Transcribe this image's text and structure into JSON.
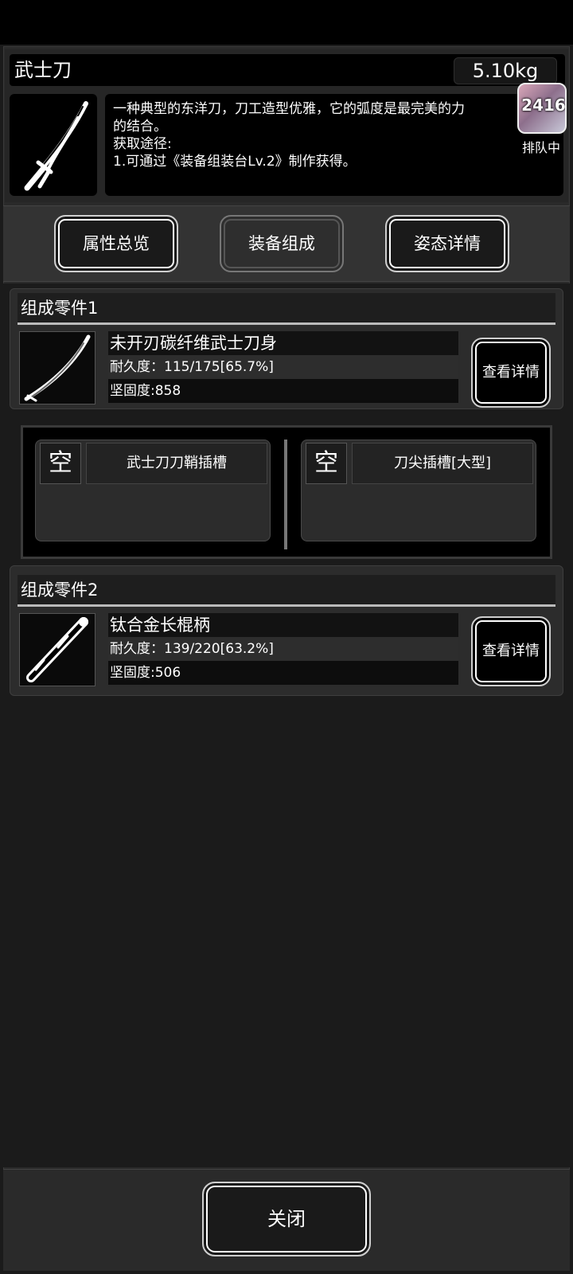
{
  "item": {
    "name": "武士刀",
    "weight": "5.10kg",
    "description_lines": [
      "一种典型的东洋刀，刀工造型优雅，它的弧度是最完美的力",
      "的结合。",
      "获取途径:",
      "1.可通过《装备组装台Lv.2》制作获得。"
    ]
  },
  "floating_badge": {
    "count": "2416",
    "label": "排队中"
  },
  "tabs": [
    {
      "label": "属性总览",
      "active": false
    },
    {
      "label": "装备组成",
      "active": true
    },
    {
      "label": "姿态详情",
      "active": false
    }
  ],
  "parts": [
    {
      "header": "组成零件1",
      "name": "未开刃碳纤维武士刀身",
      "durability": "耐久度：115/175[65.7%]",
      "hardness": "坚固度:858",
      "detail_label": "查看详情"
    },
    {
      "header": "组成零件2",
      "name": "钛合金长棍柄",
      "durability": "耐久度：139/220[63.2%]",
      "hardness": "坚固度:506",
      "detail_label": "查看详情"
    }
  ],
  "slots": [
    {
      "status": "空",
      "label": "武士刀刀鞘插槽"
    },
    {
      "status": "空",
      "label": "刀尖插槽[大型]"
    }
  ],
  "close_label": "关闭"
}
